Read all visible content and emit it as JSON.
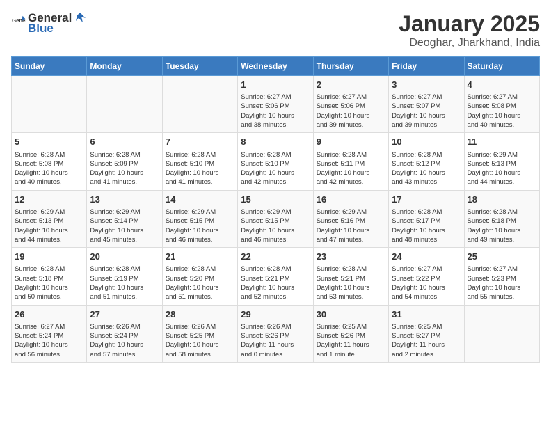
{
  "header": {
    "logo_general": "General",
    "logo_blue": "Blue",
    "title": "January 2025",
    "subtitle": "Deoghar, Jharkhand, India"
  },
  "weekdays": [
    "Sunday",
    "Monday",
    "Tuesday",
    "Wednesday",
    "Thursday",
    "Friday",
    "Saturday"
  ],
  "weeks": [
    [
      {
        "day": "",
        "info": ""
      },
      {
        "day": "",
        "info": ""
      },
      {
        "day": "",
        "info": ""
      },
      {
        "day": "1",
        "info": "Sunrise: 6:27 AM\nSunset: 5:06 PM\nDaylight: 10 hours\nand 38 minutes."
      },
      {
        "day": "2",
        "info": "Sunrise: 6:27 AM\nSunset: 5:06 PM\nDaylight: 10 hours\nand 39 minutes."
      },
      {
        "day": "3",
        "info": "Sunrise: 6:27 AM\nSunset: 5:07 PM\nDaylight: 10 hours\nand 39 minutes."
      },
      {
        "day": "4",
        "info": "Sunrise: 6:27 AM\nSunset: 5:08 PM\nDaylight: 10 hours\nand 40 minutes."
      }
    ],
    [
      {
        "day": "5",
        "info": "Sunrise: 6:28 AM\nSunset: 5:08 PM\nDaylight: 10 hours\nand 40 minutes."
      },
      {
        "day": "6",
        "info": "Sunrise: 6:28 AM\nSunset: 5:09 PM\nDaylight: 10 hours\nand 41 minutes."
      },
      {
        "day": "7",
        "info": "Sunrise: 6:28 AM\nSunset: 5:10 PM\nDaylight: 10 hours\nand 41 minutes."
      },
      {
        "day": "8",
        "info": "Sunrise: 6:28 AM\nSunset: 5:10 PM\nDaylight: 10 hours\nand 42 minutes."
      },
      {
        "day": "9",
        "info": "Sunrise: 6:28 AM\nSunset: 5:11 PM\nDaylight: 10 hours\nand 42 minutes."
      },
      {
        "day": "10",
        "info": "Sunrise: 6:28 AM\nSunset: 5:12 PM\nDaylight: 10 hours\nand 43 minutes."
      },
      {
        "day": "11",
        "info": "Sunrise: 6:29 AM\nSunset: 5:13 PM\nDaylight: 10 hours\nand 44 minutes."
      }
    ],
    [
      {
        "day": "12",
        "info": "Sunrise: 6:29 AM\nSunset: 5:13 PM\nDaylight: 10 hours\nand 44 minutes."
      },
      {
        "day": "13",
        "info": "Sunrise: 6:29 AM\nSunset: 5:14 PM\nDaylight: 10 hours\nand 45 minutes."
      },
      {
        "day": "14",
        "info": "Sunrise: 6:29 AM\nSunset: 5:15 PM\nDaylight: 10 hours\nand 46 minutes."
      },
      {
        "day": "15",
        "info": "Sunrise: 6:29 AM\nSunset: 5:15 PM\nDaylight: 10 hours\nand 46 minutes."
      },
      {
        "day": "16",
        "info": "Sunrise: 6:29 AM\nSunset: 5:16 PM\nDaylight: 10 hours\nand 47 minutes."
      },
      {
        "day": "17",
        "info": "Sunrise: 6:28 AM\nSunset: 5:17 PM\nDaylight: 10 hours\nand 48 minutes."
      },
      {
        "day": "18",
        "info": "Sunrise: 6:28 AM\nSunset: 5:18 PM\nDaylight: 10 hours\nand 49 minutes."
      }
    ],
    [
      {
        "day": "19",
        "info": "Sunrise: 6:28 AM\nSunset: 5:18 PM\nDaylight: 10 hours\nand 50 minutes."
      },
      {
        "day": "20",
        "info": "Sunrise: 6:28 AM\nSunset: 5:19 PM\nDaylight: 10 hours\nand 51 minutes."
      },
      {
        "day": "21",
        "info": "Sunrise: 6:28 AM\nSunset: 5:20 PM\nDaylight: 10 hours\nand 51 minutes."
      },
      {
        "day": "22",
        "info": "Sunrise: 6:28 AM\nSunset: 5:21 PM\nDaylight: 10 hours\nand 52 minutes."
      },
      {
        "day": "23",
        "info": "Sunrise: 6:28 AM\nSunset: 5:21 PM\nDaylight: 10 hours\nand 53 minutes."
      },
      {
        "day": "24",
        "info": "Sunrise: 6:27 AM\nSunset: 5:22 PM\nDaylight: 10 hours\nand 54 minutes."
      },
      {
        "day": "25",
        "info": "Sunrise: 6:27 AM\nSunset: 5:23 PM\nDaylight: 10 hours\nand 55 minutes."
      }
    ],
    [
      {
        "day": "26",
        "info": "Sunrise: 6:27 AM\nSunset: 5:24 PM\nDaylight: 10 hours\nand 56 minutes."
      },
      {
        "day": "27",
        "info": "Sunrise: 6:26 AM\nSunset: 5:24 PM\nDaylight: 10 hours\nand 57 minutes."
      },
      {
        "day": "28",
        "info": "Sunrise: 6:26 AM\nSunset: 5:25 PM\nDaylight: 10 hours\nand 58 minutes."
      },
      {
        "day": "29",
        "info": "Sunrise: 6:26 AM\nSunset: 5:26 PM\nDaylight: 11 hours\nand 0 minutes."
      },
      {
        "day": "30",
        "info": "Sunrise: 6:25 AM\nSunset: 5:26 PM\nDaylight: 11 hours\nand 1 minute."
      },
      {
        "day": "31",
        "info": "Sunrise: 6:25 AM\nSunset: 5:27 PM\nDaylight: 11 hours\nand 2 minutes."
      },
      {
        "day": "",
        "info": ""
      }
    ]
  ]
}
